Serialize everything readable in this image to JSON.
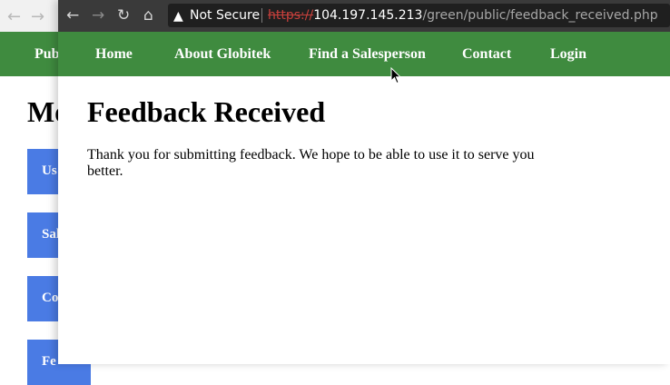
{
  "background_window": {
    "nav_partial_label": "Pub",
    "heading_partial": "Me",
    "buttons": [
      "Us",
      "Sal",
      "Co",
      "Fe"
    ]
  },
  "browser": {
    "security_label": "Not Secure",
    "url_scheme": "https://",
    "url_host": "104.197.145.213",
    "url_path": "/green/public/feedback_received.php"
  },
  "nav": {
    "items": [
      "Home",
      "About Globitek",
      "Find a Salesperson",
      "Contact",
      "Login"
    ]
  },
  "page": {
    "title": "Feedback Received",
    "message": "Thank you for submitting feedback. We hope to be able to use it to serve you better."
  },
  "colors": {
    "nav_green": "#3f8b3f",
    "button_blue": "#4a7be4",
    "insecure_red": "#c8403c"
  }
}
